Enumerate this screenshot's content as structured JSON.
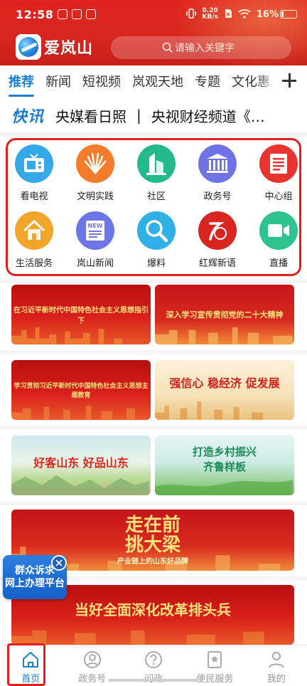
{
  "status_bar": {
    "time": "12:58",
    "net_speed": "0.20",
    "net_unit": "KB/s",
    "battery": "16%"
  },
  "header": {
    "app_name": "爱岚山",
    "search_placeholder": "请输入关键字"
  },
  "tabs": [
    "推荐",
    "新闻",
    "短视频",
    "岚观天地",
    "专题",
    "文化惠"
  ],
  "ticker": {
    "label": "快讯",
    "item1": "央媒看日照",
    "separator": "|",
    "item2": "央视财经频道《…"
  },
  "grid": [
    {
      "label": "看电视",
      "icon": "tv-icon",
      "color": "#35a9e8"
    },
    {
      "label": "文明实践",
      "icon": "fan-icon",
      "color": "#f37b2a"
    },
    {
      "label": "社区",
      "icon": "buildings-icon",
      "color": "#24b98d"
    },
    {
      "label": "政务号",
      "icon": "government-building-icon",
      "color": "#6f73e6"
    },
    {
      "label": "中心组",
      "icon": "document-icon",
      "color": "#e8342e"
    },
    {
      "label": "生活服务",
      "icon": "house-icon",
      "color": "#f1a62a"
    },
    {
      "label": "岚山新闻",
      "icon": "newspaper-icon",
      "color": "#6c76e6"
    },
    {
      "label": "爆料",
      "icon": "magnifier-icon",
      "color": "#2fb0e6"
    },
    {
      "label": "红辉新语",
      "icon": "hongyun-logo-icon",
      "color": "#d8251f"
    },
    {
      "label": "直播",
      "icon": "video-camera-icon",
      "color": "#2ec28f"
    }
  ],
  "banners": {
    "b1": "在习近平新时代中国特色社会主义思想指引下",
    "b2": "深入学习宣传贯彻党的二十大精神",
    "b3": "学习贯彻习近平新时代中国特色社会主义思想主题教育",
    "b4": "强信心 稳经济 促发展",
    "b5": "好客山东 好品山东",
    "b6_line1": "打造乡村振兴",
    "b6_line2": "齐鲁样板",
    "b7_line1": "走在前",
    "b7_line2": "挑大梁",
    "b7_sub": "产业链上的山东好品牌",
    "b8": "当好全面深化改革排头兵"
  },
  "float_widget": {
    "line1": "群众诉求",
    "line2": "网上办理平台"
  },
  "bottom_nav": [
    "首页",
    "政务号",
    "问政",
    "便民服务",
    "我的"
  ],
  "colors": {
    "brand_red": "#d8261f",
    "accent_blue": "#1a7fd4",
    "highlight_red": "#e0201d"
  }
}
